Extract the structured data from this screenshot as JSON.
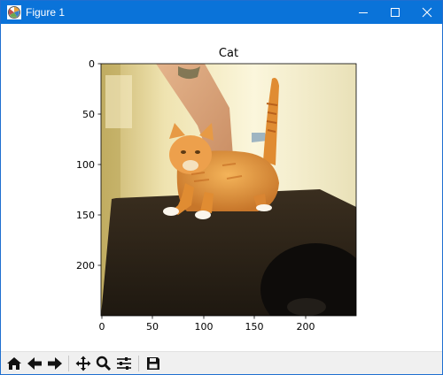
{
  "window": {
    "title": "Figure 1",
    "accent_color": "#0a73d9"
  },
  "figure": {
    "title": "Cat",
    "x_ticks": [
      "0",
      "50",
      "100",
      "150",
      "200"
    ],
    "y_ticks": [
      "0",
      "50",
      "100",
      "150",
      "200"
    ],
    "image_subject": "orange tabby cat standing on a dark table, a hand petting its back"
  },
  "toolbar": {
    "icons": [
      "home-icon",
      "back-arrow-icon",
      "forward-arrow-icon",
      "pan-move-icon",
      "zoom-magnifier-icon",
      "configure-subplots-icon",
      "save-floppy-icon"
    ]
  }
}
